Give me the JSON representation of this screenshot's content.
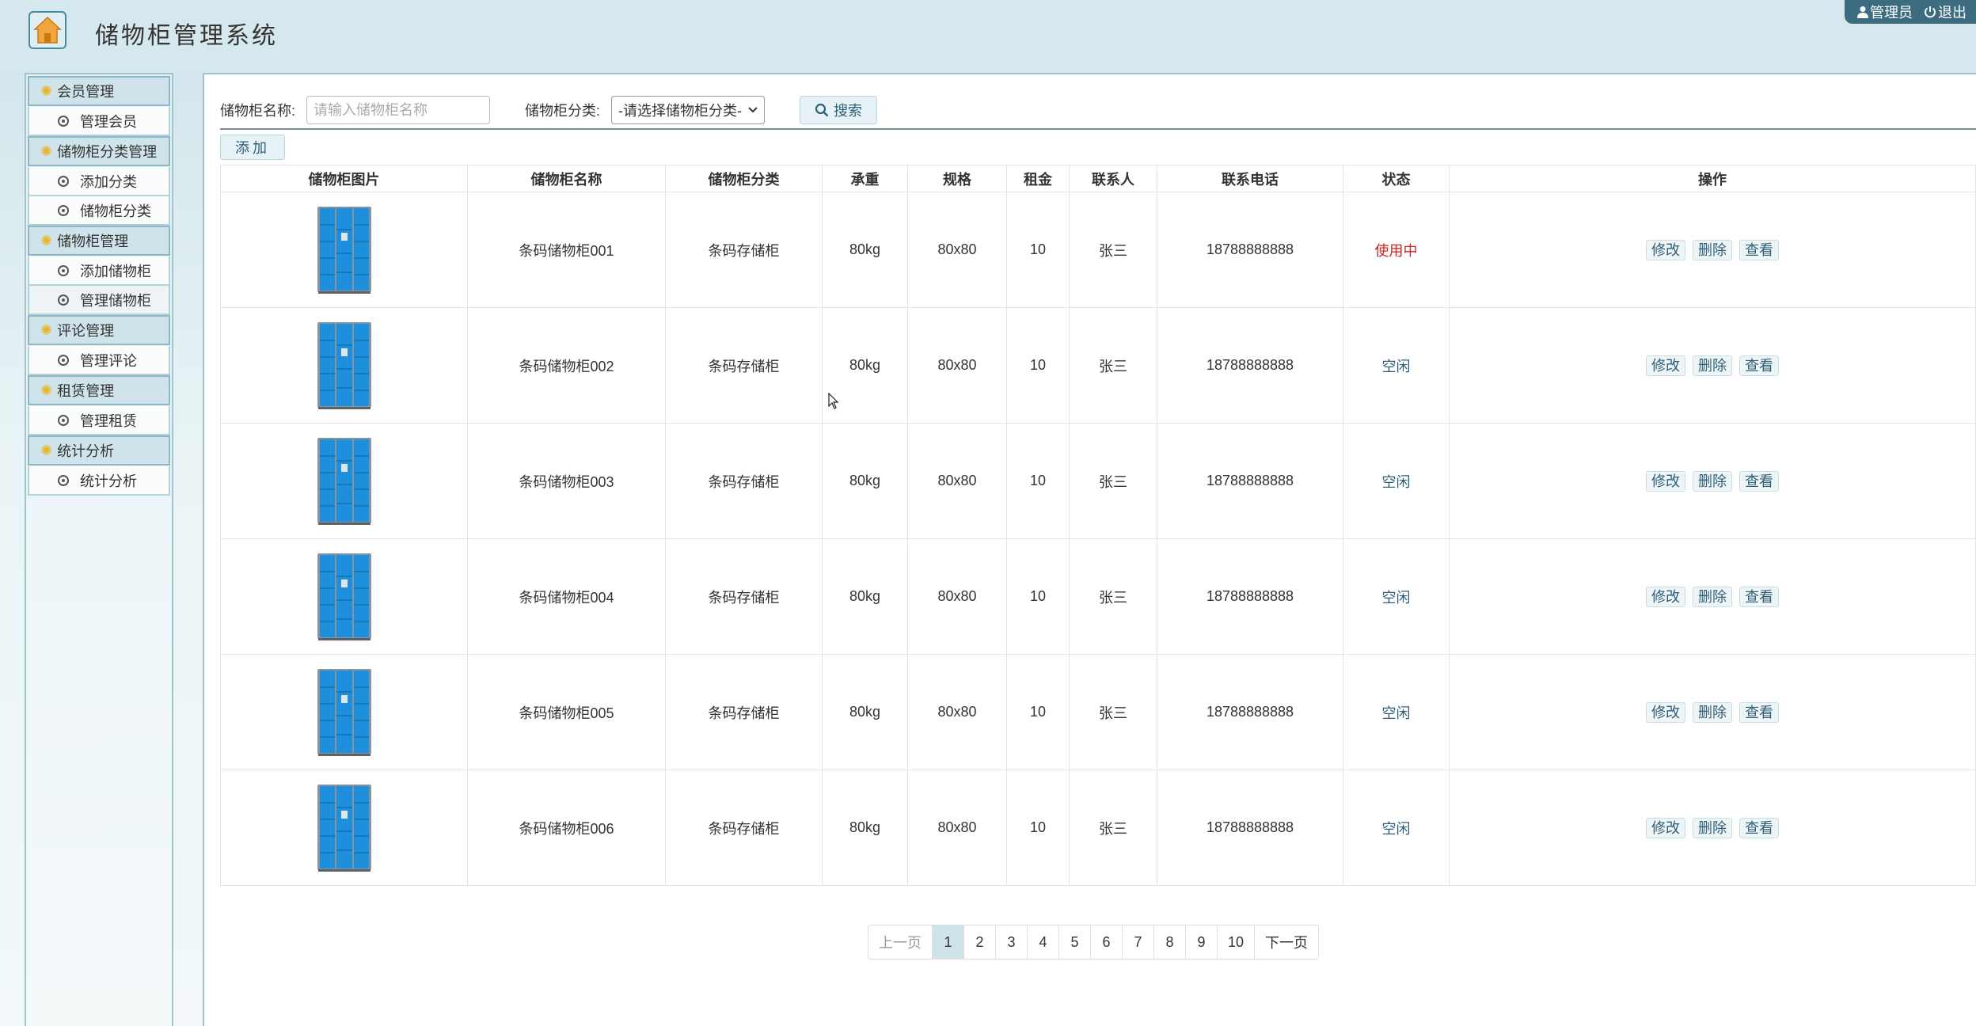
{
  "app": {
    "title": "储物柜管理系统",
    "user_label": "管理员",
    "logout_label": "退出"
  },
  "sidebar": {
    "groups": [
      {
        "label": "会员管理",
        "items": [
          {
            "label": "管理会员"
          }
        ]
      },
      {
        "label": "储物柜分类管理",
        "items": [
          {
            "label": "添加分类"
          },
          {
            "label": "储物柜分类"
          }
        ]
      },
      {
        "label": "储物柜管理",
        "items": [
          {
            "label": "添加储物柜"
          },
          {
            "label": "管理储物柜",
            "active": true
          }
        ]
      },
      {
        "label": "评论管理",
        "items": [
          {
            "label": "管理评论"
          }
        ]
      },
      {
        "label": "租赁管理",
        "items": [
          {
            "label": "管理租赁"
          }
        ]
      },
      {
        "label": "统计分析",
        "items": [
          {
            "label": "统计分析"
          }
        ]
      }
    ]
  },
  "search": {
    "name_label": "储物柜名称:",
    "name_placeholder": "请输入储物柜名称",
    "category_label": "储物柜分类:",
    "category_selected": "-请选择储物柜分类-",
    "search_button": "搜索",
    "add_button": "添加"
  },
  "table": {
    "columns": [
      "储物柜图片",
      "储物柜名称",
      "储物柜分类",
      "承重",
      "规格",
      "租金",
      "联系人",
      "联系电话",
      "状态",
      "操作"
    ],
    "actions": {
      "edit": "修改",
      "delete": "删除",
      "view": "查看"
    },
    "rows": [
      {
        "name": "条码储物柜001",
        "category": "条码存储柜",
        "load": "80kg",
        "size": "80x80",
        "rent": "10",
        "contact": "张三",
        "phone": "18788888888",
        "status": "使用中",
        "busy": true
      },
      {
        "name": "条码储物柜002",
        "category": "条码存储柜",
        "load": "80kg",
        "size": "80x80",
        "rent": "10",
        "contact": "张三",
        "phone": "18788888888",
        "status": "空闲",
        "busy": false
      },
      {
        "name": "条码储物柜003",
        "category": "条码存储柜",
        "load": "80kg",
        "size": "80x80",
        "rent": "10",
        "contact": "张三",
        "phone": "18788888888",
        "status": "空闲",
        "busy": false
      },
      {
        "name": "条码储物柜004",
        "category": "条码存储柜",
        "load": "80kg",
        "size": "80x80",
        "rent": "10",
        "contact": "张三",
        "phone": "18788888888",
        "status": "空闲",
        "busy": false
      },
      {
        "name": "条码储物柜005",
        "category": "条码存储柜",
        "load": "80kg",
        "size": "80x80",
        "rent": "10",
        "contact": "张三",
        "phone": "18788888888",
        "status": "空闲",
        "busy": false
      },
      {
        "name": "条码储物柜006",
        "category": "条码存储柜",
        "load": "80kg",
        "size": "80x80",
        "rent": "10",
        "contact": "张三",
        "phone": "18788888888",
        "status": "空闲",
        "busy": false
      }
    ]
  },
  "pagination": {
    "prev": "上一页",
    "pages": [
      "1",
      "2",
      "3",
      "4",
      "5",
      "6",
      "7",
      "8",
      "9",
      "10"
    ],
    "current": "1",
    "next": "下一页"
  },
  "colors": {
    "accent": "#2f5e78",
    "busy": "#cc2222",
    "locker_blue": "#1e8fdc"
  }
}
